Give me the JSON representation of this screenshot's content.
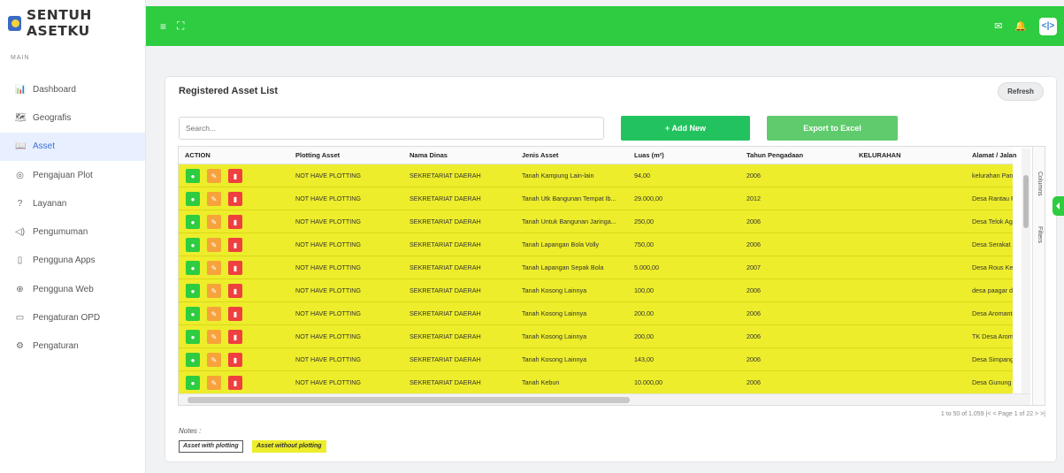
{
  "brand": {
    "name": "SENTUH ASETKU"
  },
  "sidebar": {
    "section": "MAIN",
    "items": [
      {
        "label": "Dashboard",
        "icon": "bar-chart-icon",
        "glyph": "📊"
      },
      {
        "label": "Geografis",
        "icon": "map-icon",
        "glyph": "🗺"
      },
      {
        "label": "Asset",
        "icon": "book-icon",
        "glyph": "📖"
      },
      {
        "label": "Pengajuan Plot",
        "icon": "pin-icon",
        "glyph": "◎"
      },
      {
        "label": "Layanan",
        "icon": "question-icon",
        "glyph": "?"
      },
      {
        "label": "Pengumuman",
        "icon": "megaphone-icon",
        "glyph": "◁)"
      },
      {
        "label": "Pengguna Apps",
        "icon": "phone-icon",
        "glyph": "▯"
      },
      {
        "label": "Pengguna Web",
        "icon": "globe-icon",
        "glyph": "⊕"
      },
      {
        "label": "Pengaturan OPD",
        "icon": "monitor-icon",
        "glyph": "▭"
      },
      {
        "label": "Pengaturan",
        "icon": "gear-icon",
        "glyph": "⚙"
      }
    ],
    "active_index": 2
  },
  "topbar": {
    "menu_glyph": "≡",
    "fullscreen_glyph": "⛶",
    "mail_glyph": "✉",
    "bell_glyph": "🔔",
    "avatar_text": "<|>"
  },
  "card": {
    "title": "Registered Asset List",
    "refresh_label": "Refresh",
    "search_placeholder": "Search...",
    "add_label": "+ Add New",
    "export_label": "Export to Excel"
  },
  "grid": {
    "columns": [
      "ACTION",
      "Plotting Asset",
      "Nama Dinas",
      "Jenis Asset",
      "Luas (m²)",
      "Tahun Pengadaan",
      "KELURAHAN",
      "Alamat / Jalan"
    ],
    "rows": [
      [
        "NOT HAVE PLOTTING",
        "SEKRETARIAT DAERAH",
        "Tanah Kampung Lain-lain",
        "94,00",
        "2006",
        "",
        "kelurahan Pancur"
      ],
      [
        "NOT HAVE PLOTTING",
        "SEKRETARIAT DAERAH",
        "Tanah Utk Bangunan Tempat Ib...",
        "29.000,00",
        "2012",
        "",
        "Desa Rantau Panj"
      ],
      [
        "NOT HAVE PLOTTING",
        "SEKRETARIAT DAERAH",
        "Tanah Untuk Bangunan Jaringa...",
        "250,00",
        "2006",
        "",
        "Desa Telok Agung"
      ],
      [
        "NOT HAVE PLOTTING",
        "SEKRETARIAT DAERAH",
        "Tanah Lapangan Bola Volly",
        "750,00",
        "2006",
        "",
        "Desa Serakat Jaya"
      ],
      [
        "NOT HAVE PLOTTING",
        "SEKRETARIAT DAERAH",
        "Tanah Lapangan Sepak Bola",
        "5.000,00",
        "2007",
        "",
        "Desa Rous Kec.Bu"
      ],
      [
        "NOT HAVE PLOTTING",
        "SEKRETARIAT DAERAH",
        "Tanah Kosong Lainnya",
        "100,00",
        "2006",
        "",
        "desa paagar dew"
      ],
      [
        "NOT HAVE PLOTTING",
        "SEKRETARIAT DAERAH",
        "Tanah Kosong Lainnya",
        "200,00",
        "2006",
        "",
        "Desa Aromantai I"
      ],
      [
        "NOT HAVE PLOTTING",
        "SEKRETARIAT DAERAH",
        "Tanah Kosong Lainnya",
        "200,00",
        "2006",
        "",
        "TK Desa Aromant"
      ],
      [
        "NOT HAVE PLOTTING",
        "SEKRETARIAT DAERAH",
        "Tanah Kosong Lainnya",
        "143,00",
        "2006",
        "",
        "Desa Simpang Se"
      ],
      [
        "NOT HAVE PLOTTING",
        "SEKRETARIAT DAERAH",
        "Tanah Kebun",
        "10.000,00",
        "2006",
        "",
        "Desa Gunung Ter"
      ]
    ],
    "action_glyphs": {
      "view": "●",
      "edit": "✎",
      "delete": "▮"
    },
    "tool_columns": "Columns",
    "tool_filters": "Filters"
  },
  "pager": {
    "text": "1 to 50 of 1,059   |<  <  Page 1 of 22  >  >|"
  },
  "notes": {
    "title": "Notes :",
    "with_plotting": "Asset with plotting",
    "without_plotting": "Asset without plotting"
  },
  "colors": {
    "brand_green": "#2ecc40",
    "row_yellow": "#eded2b",
    "active_blue": "#3d6fd6"
  }
}
